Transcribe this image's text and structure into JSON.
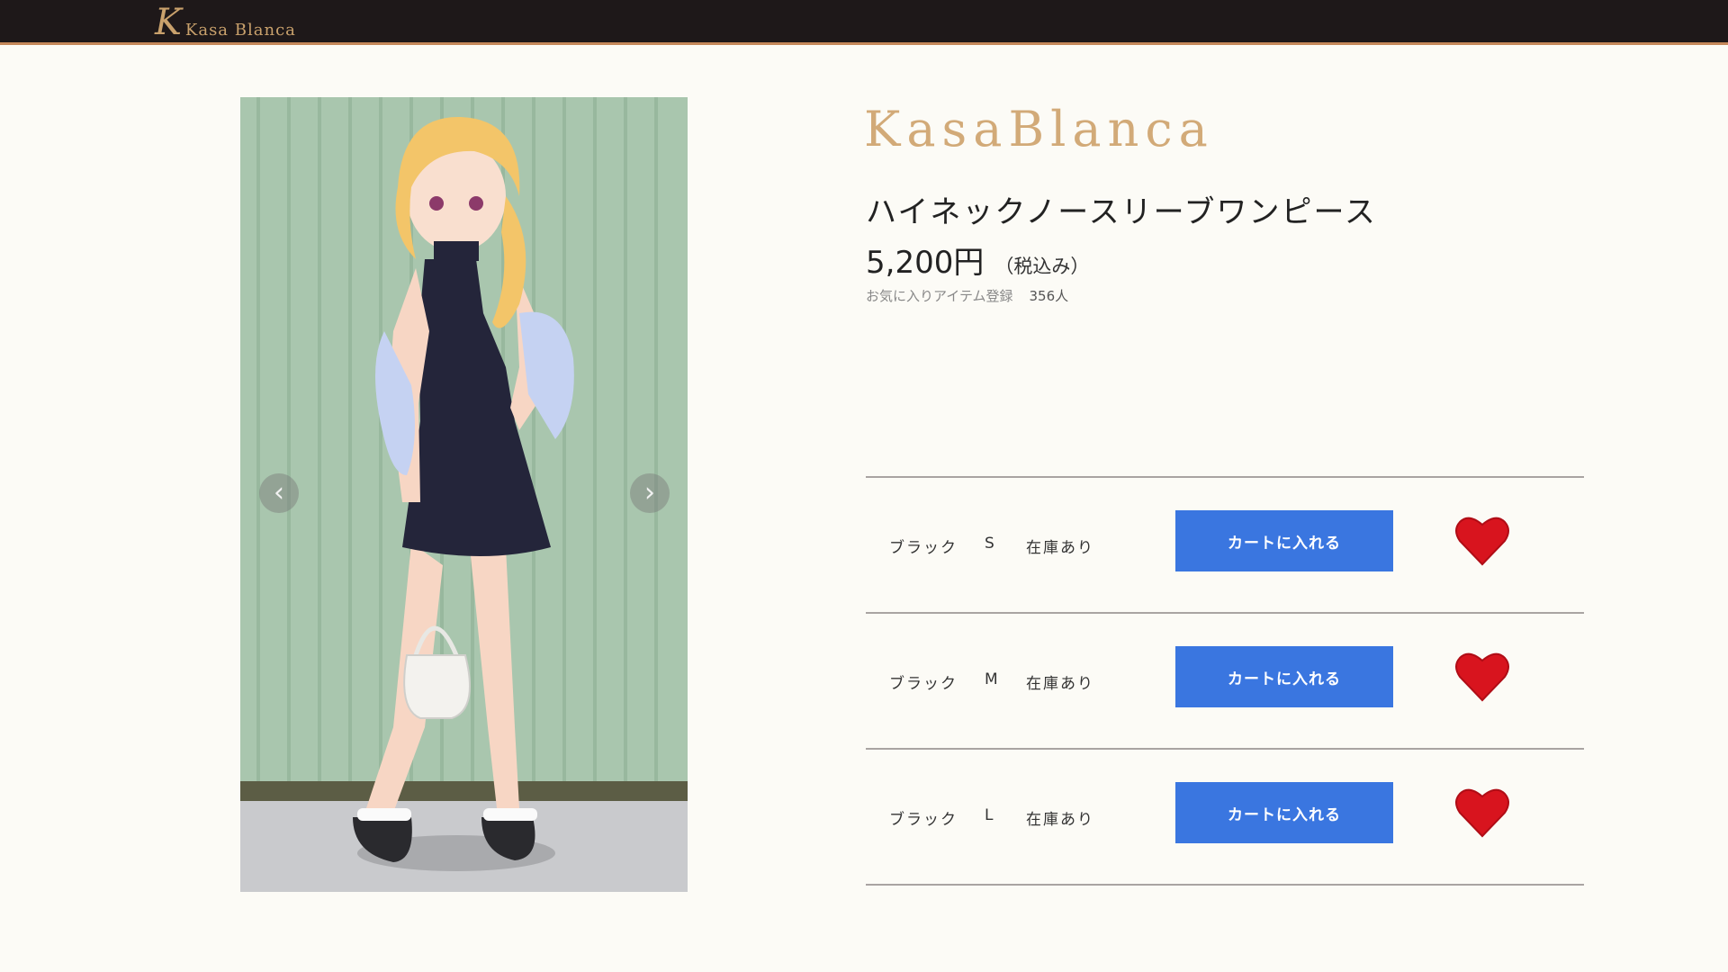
{
  "header": {
    "logo_mark": "K",
    "logo_text": "Kasa Blanca"
  },
  "gallery": {
    "prev_arrow": "‹",
    "next_arrow": "›"
  },
  "product": {
    "brand": "KasaBlanca",
    "title": "ハイネックノースリーブワンピース",
    "price": "5,200円",
    "tax_note": "（税込み）",
    "favorite_label": "お気に入りアイテム登録",
    "favorite_count": "356人"
  },
  "variants": [
    {
      "color": "ブラック",
      "size": "S",
      "stock": "在庫あり",
      "button": "カートに入れる"
    },
    {
      "color": "ブラック",
      "size": "M",
      "stock": "在庫あり",
      "button": "カートに入れる"
    },
    {
      "color": "ブラック",
      "size": "L",
      "stock": "在庫あり",
      "button": "カートに入れる"
    }
  ],
  "colors": {
    "header_bg": "#1e1819",
    "header_accent": "#c5885a",
    "brand": "#d2aa78",
    "cart_button": "#3a76e0",
    "heart": "#d8141e"
  },
  "icons": {
    "favorite": "heart-icon",
    "prev": "chevron-left-icon",
    "next": "chevron-right-icon"
  }
}
